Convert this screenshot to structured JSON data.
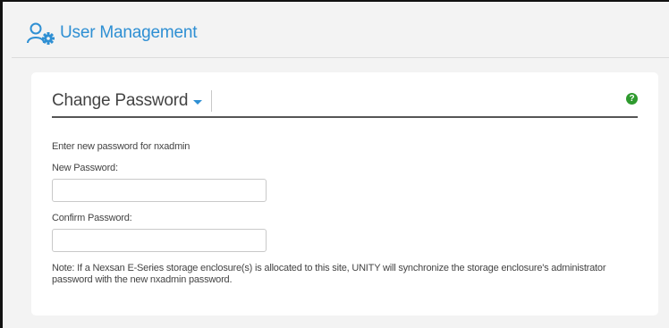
{
  "header": {
    "title": "User Management",
    "icon": "user-gear-icon",
    "accent_color": "#2e8fd3"
  },
  "card": {
    "title": "Change Password",
    "help_icon": "help-icon",
    "help_color": "#2e9a2e",
    "intro": "Enter new password for nxadmin",
    "new_password_label": "New Password:",
    "new_password_value": "",
    "confirm_password_label": "Confirm Password:",
    "confirm_password_value": "",
    "note": "Note: If a Nexsan E-Series storage enclosure(s) is allocated to this site, UNITY will synchronize the storage enclosure's administrator password with the new nxadmin password."
  }
}
